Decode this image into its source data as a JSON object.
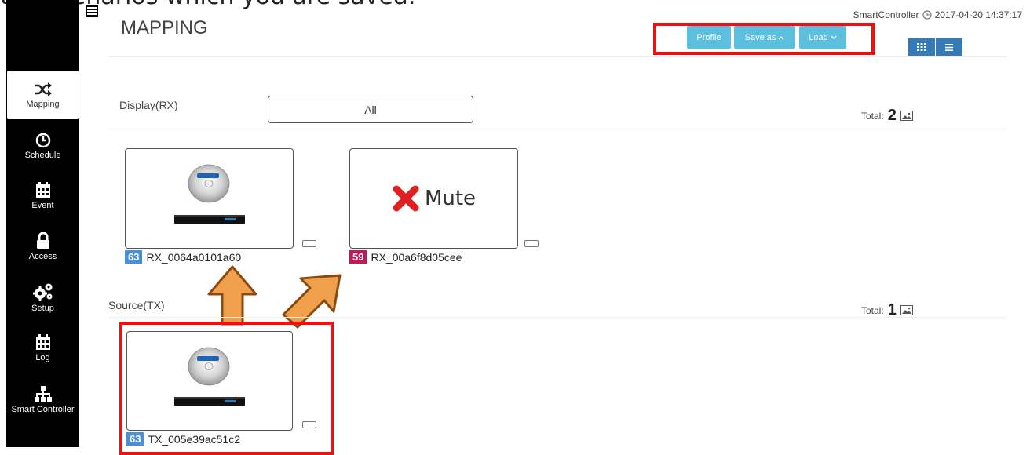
{
  "caption": "the scenarios which you are saved.",
  "sidebar": {
    "items": [
      {
        "label": "Mapping",
        "icon": "shuffle-icon",
        "active": true
      },
      {
        "label": "Schedule",
        "icon": "clock-icon"
      },
      {
        "label": "Event",
        "icon": "calendar-icon"
      },
      {
        "label": "Access",
        "icon": "lock-icon"
      },
      {
        "label": "Setup",
        "icon": "gears-icon"
      },
      {
        "label": "Log",
        "icon": "calendar-icon"
      },
      {
        "label": "Smart Controller",
        "icon": "sitemap-icon"
      }
    ]
  },
  "header": {
    "title": "MAPPING",
    "device_name": "SmartController",
    "datetime": "2017-04-20 14:37:17"
  },
  "toolbar": {
    "profile_label": "Profile",
    "save_as_label": "Save as",
    "load_label": "Load"
  },
  "display_section": {
    "label": "Display(RX)",
    "filter_value": "All",
    "total_label": "Total:",
    "total_count": "2",
    "cards": [
      {
        "id_badge": "63",
        "badge_color": "#4a90d9",
        "name": "RX_0064a0101a60",
        "content": "blu-ray-player"
      },
      {
        "id_badge": "59",
        "badge_color": "#c2185b",
        "name": "RX_00a6f8d05cee",
        "content": "mute",
        "mute_label": "Mute"
      }
    ]
  },
  "source_section": {
    "label": "Source(TX)",
    "total_label": "Total:",
    "total_count": "1",
    "cards": [
      {
        "id_badge": "63",
        "badge_color": "#4a90d9",
        "name": "TX_005e39ac51c2",
        "content": "blu-ray-player"
      }
    ]
  },
  "colors": {
    "accent": "#5bc0de",
    "view_toggle": "#337ab7",
    "highlight": "#ee1111",
    "arrow_fill": "#f0a04b",
    "arrow_stroke": "#8b4a10"
  }
}
